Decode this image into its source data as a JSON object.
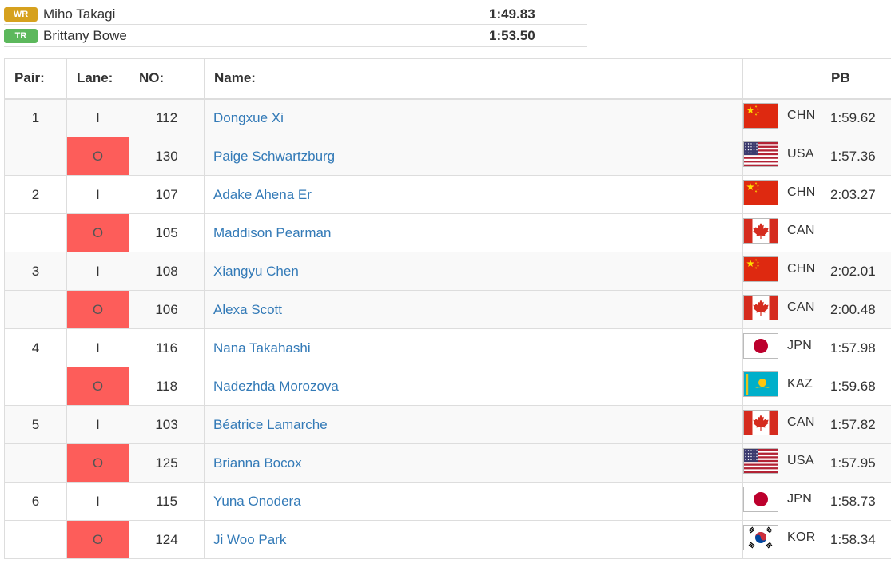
{
  "records": [
    {
      "badge": "WR",
      "badge_color": "#d6a11e",
      "name": "Miho Takagi",
      "time": "1:49.83"
    },
    {
      "badge": "TR",
      "badge_color": "#5cb85c",
      "name": "Brittany Bowe",
      "time": "1:53.50"
    }
  ],
  "table": {
    "headers": {
      "pair": "Pair:",
      "lane": "Lane:",
      "no": "NO:",
      "name": "Name:",
      "pb": "PB"
    },
    "rows": [
      {
        "pair": "1",
        "lane": "I",
        "no": "112",
        "name": "Dongxue Xi",
        "flag": "china-flag",
        "nat": "CHN",
        "pb": "1:59.62"
      },
      {
        "pair": "",
        "lane": "O",
        "no": "130",
        "name": "Paige Schwartzburg",
        "flag": "usa-flag",
        "nat": "USA",
        "pb": "1:57.36"
      },
      {
        "pair": "2",
        "lane": "I",
        "no": "107",
        "name": "Adake Ahena Er",
        "flag": "china-flag",
        "nat": "CHN",
        "pb": "2:03.27"
      },
      {
        "pair": "",
        "lane": "O",
        "no": "105",
        "name": "Maddison Pearman",
        "flag": "canada-flag",
        "nat": "CAN",
        "pb": ""
      },
      {
        "pair": "3",
        "lane": "I",
        "no": "108",
        "name": "Xiangyu Chen",
        "flag": "china-flag",
        "nat": "CHN",
        "pb": "2:02.01"
      },
      {
        "pair": "",
        "lane": "O",
        "no": "106",
        "name": "Alexa Scott",
        "flag": "canada-flag",
        "nat": "CAN",
        "pb": "2:00.48"
      },
      {
        "pair": "4",
        "lane": "I",
        "no": "116",
        "name": "Nana Takahashi",
        "flag": "japan-flag",
        "nat": "JPN",
        "pb": "1:57.98"
      },
      {
        "pair": "",
        "lane": "O",
        "no": "118",
        "name": "Nadezhda Morozova",
        "flag": "kazakhstan-flag",
        "nat": "KAZ",
        "pb": "1:59.68"
      },
      {
        "pair": "5",
        "lane": "I",
        "no": "103",
        "name": "Béatrice Lamarche",
        "flag": "canada-flag",
        "nat": "CAN",
        "pb": "1:57.82"
      },
      {
        "pair": "",
        "lane": "O",
        "no": "125",
        "name": "Brianna Bocox",
        "flag": "usa-flag",
        "nat": "USA",
        "pb": "1:57.95"
      },
      {
        "pair": "6",
        "lane": "I",
        "no": "115",
        "name": "Yuna Onodera",
        "flag": "japan-flag",
        "nat": "JPN",
        "pb": "1:58.73"
      },
      {
        "pair": "",
        "lane": "O",
        "no": "124",
        "name": "Ji Woo Park",
        "flag": "korea-flag",
        "nat": "KOR",
        "pb": "1:58.34"
      }
    ]
  },
  "colors": {
    "link": "#337ab7",
    "outer_lane": "#fd5d5a",
    "border": "#dddddd",
    "stripe": "#f9f9f9"
  }
}
